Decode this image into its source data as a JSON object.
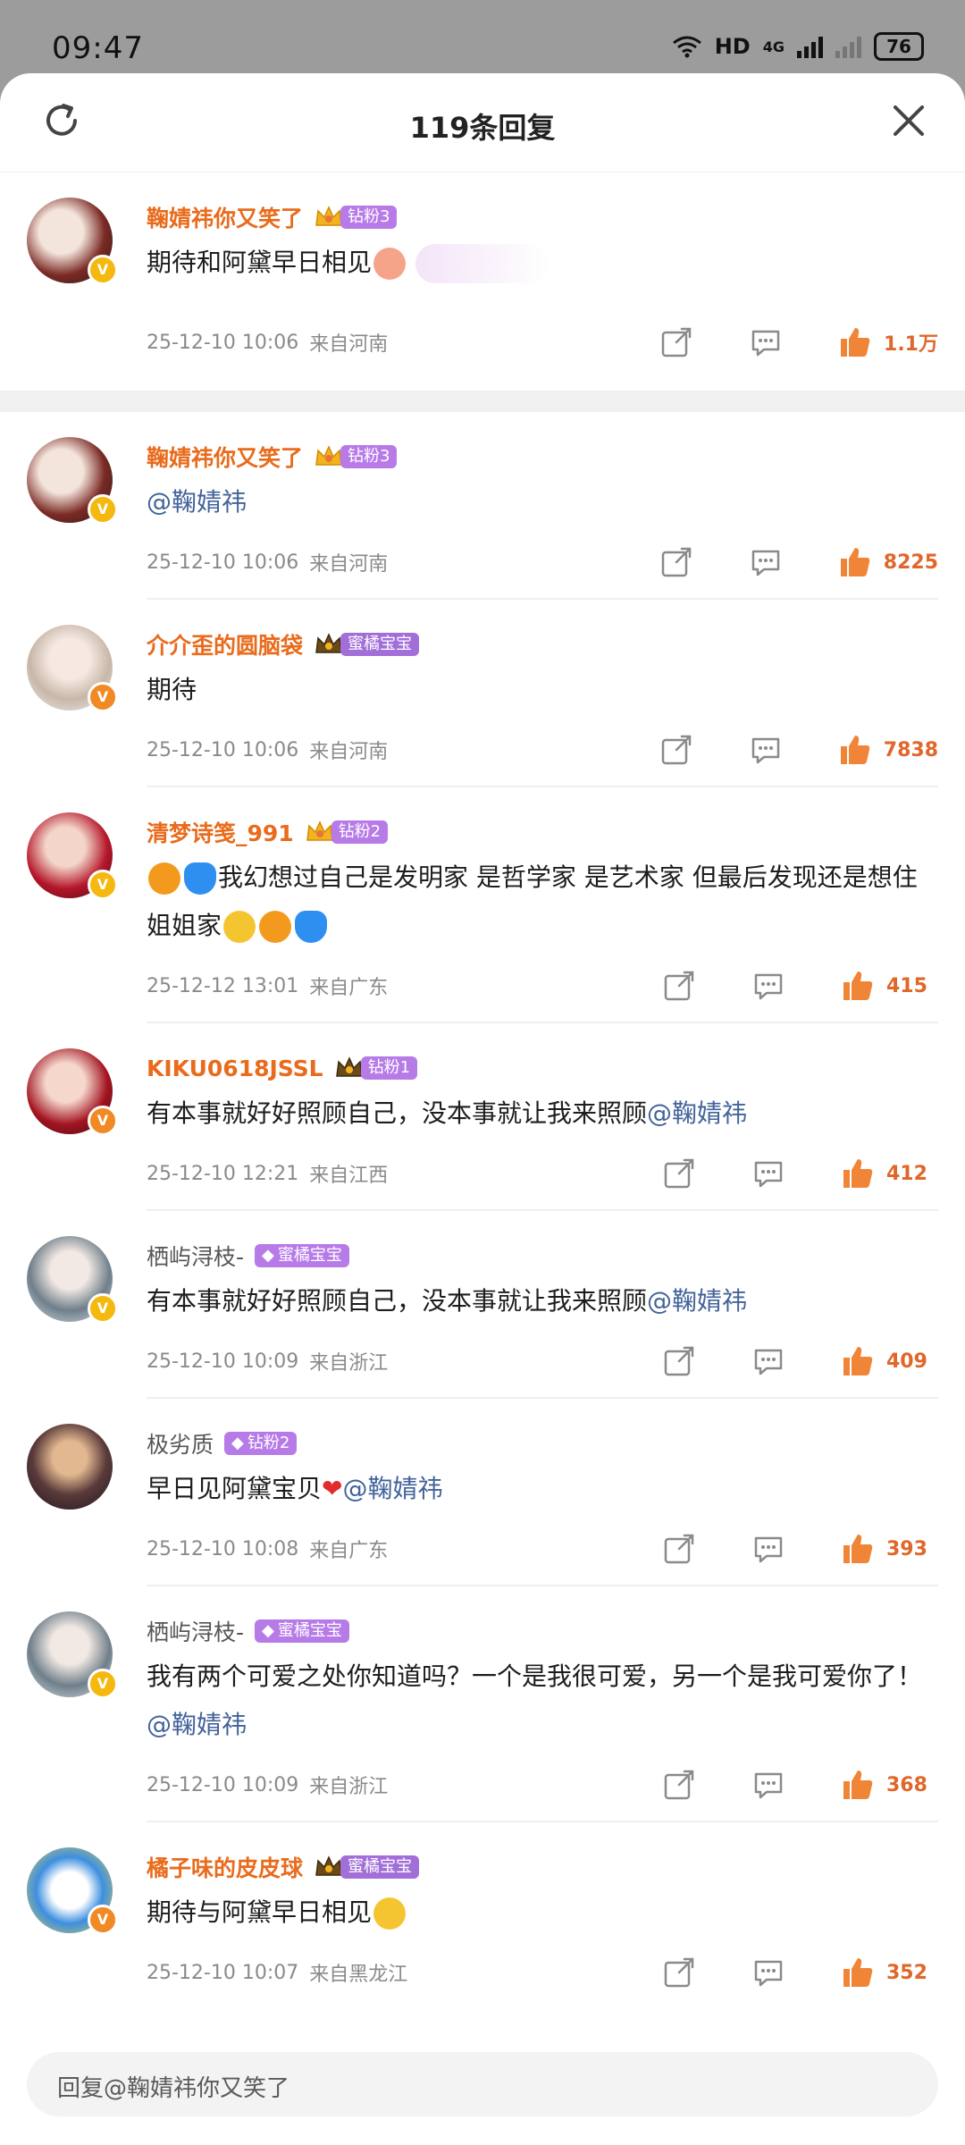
{
  "status": {
    "time": "09:47",
    "hd": "HD",
    "net": "4G",
    "battery": "76"
  },
  "sheet": {
    "title": "119条回复"
  },
  "comments": [
    {
      "name": "鞠婧祎你又笑了",
      "tag": "钻粉3",
      "text": "期待和阿黛早日相见",
      "mention": "",
      "time": "25-12-10  10:06",
      "loc": "来自河南",
      "likes": "1.1万"
    },
    {
      "name": "鞠婧祎你又笑了",
      "tag": "钻粉3",
      "text": "",
      "mention": "@鞠婧祎",
      "time": "25-12-10  10:06",
      "loc": "来自河南",
      "likes": "8225"
    },
    {
      "name": "介介歪的圆脑袋",
      "tag": "蜜橘宝宝",
      "text": "期待",
      "mention": "",
      "time": "25-12-10  10:06",
      "loc": "来自河南",
      "likes": "7838"
    },
    {
      "name": "清梦诗笺_991",
      "tag": "钻粉2",
      "text": "我幻想过自己是发明家 是哲学家 是艺术家 但最后发现还是想住姐姐家",
      "mention": "",
      "time": "25-12-12  13:01",
      "loc": "来自广东",
      "likes": "415"
    },
    {
      "name": "KIKU0618JSSL",
      "tag": "钻粉1",
      "text": "有本事就好好照顾自己，没本事就让我来照顾",
      "mention": "@鞠婧祎",
      "time": "25-12-10  12:21",
      "loc": "来自江西",
      "likes": "412"
    },
    {
      "name": "栖屿浔枝-",
      "tag": "蜜橘宝宝",
      "text": "有本事就好好照顾自己，没本事就让我来照顾",
      "mention": "@鞠婧祎",
      "time": "25-12-10  10:09",
      "loc": "来自浙江",
      "likes": "409"
    },
    {
      "name": "极劣质",
      "tag": "钻粉2",
      "text": "早日见阿黛宝贝",
      "mention": "@鞠婧祎",
      "time": "25-12-10  10:08",
      "loc": "来自广东",
      "likes": "393"
    },
    {
      "name": "栖屿浔枝-",
      "tag": "蜜橘宝宝",
      "text": "我有两个可爱之处你知道吗？一个是我很可爱，另一个是我可爱你了！",
      "mention": "@鞠婧祎",
      "time": "25-12-10  10:09",
      "loc": "来自浙江",
      "likes": "368"
    },
    {
      "name": "橘子味的皮皮球",
      "tag": "蜜橘宝宝",
      "text": "期待与阿黛早日相见",
      "mention": "",
      "time": "25-12-10  10:07",
      "loc": "来自黑龙江",
      "likes": "352"
    }
  ],
  "reply": {
    "placeholder": "回复@鞠婧祎你又笑了"
  },
  "colors": {
    "name_orange": "#e96b1c",
    "like_orange": "#e0672a",
    "mention_blue": "#43639a",
    "tag_purple": "#b77be8"
  },
  "icons": [
    "refresh-icon",
    "close-icon",
    "share-icon",
    "reply-icon",
    "like-icon",
    "crown-icon",
    "verified-badge-icon",
    "wifi-icon",
    "signal-icon",
    "battery-icon"
  ]
}
